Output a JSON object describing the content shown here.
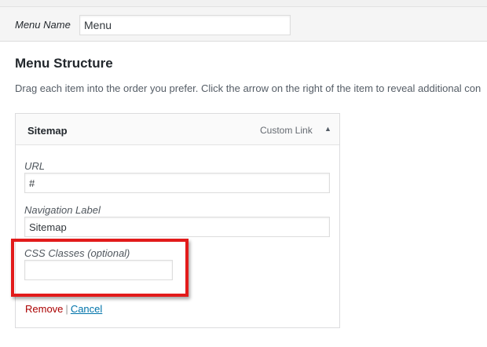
{
  "menu_name": {
    "label": "Menu Name",
    "value": "Menu"
  },
  "menu_structure": {
    "title": "Menu Structure",
    "instructions": "Drag each item into the order you prefer. Click the arrow on the right of the item to reveal additional con"
  },
  "menu_item": {
    "title": "Sitemap",
    "type": "Custom Link",
    "arrow": "▲",
    "fields": {
      "url_label": "URL",
      "url_value": "#",
      "nav_label": "Navigation Label",
      "nav_value": "Sitemap",
      "css_label": "CSS Classes (optional)",
      "css_value": ""
    },
    "actions": {
      "remove": "Remove",
      "separator": "|",
      "cancel": "Cancel"
    }
  },
  "colors": {
    "highlight_border": "#e21b1b",
    "remove_link": "#aa0000",
    "cancel_link": "#0073aa"
  },
  "icons": {
    "collapse_arrow": "up-triangle-icon"
  }
}
